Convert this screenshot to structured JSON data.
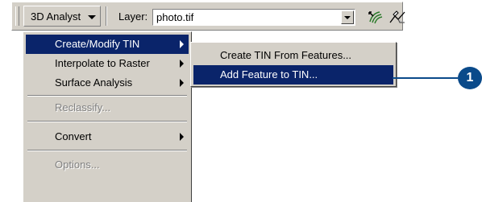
{
  "toolbar": {
    "analyst_button_label": "3D Analyst",
    "layer_label": "Layer:",
    "layer_value": "photo.tif",
    "tool_icons": [
      "contour-tool-icon",
      "interpolate-line-tool-icon"
    ]
  },
  "menu": {
    "items": [
      {
        "label": "Create/Modify TIN",
        "submenu": true,
        "highlighted": true,
        "disabled": false
      },
      {
        "label": "Interpolate to Raster",
        "submenu": true,
        "highlighted": false,
        "disabled": false
      },
      {
        "label": "Surface Analysis",
        "submenu": true,
        "highlighted": false,
        "disabled": false
      },
      {
        "label": "Reclassify...",
        "submenu": false,
        "highlighted": false,
        "disabled": true
      },
      {
        "label": "Convert",
        "submenu": true,
        "highlighted": false,
        "disabled": false
      },
      {
        "label": "Options...",
        "submenu": false,
        "highlighted": false,
        "disabled": true
      }
    ]
  },
  "submenu": {
    "items": [
      {
        "label": "Create TIN From Features...",
        "highlighted": false
      },
      {
        "label": "Add Feature to TIN...",
        "highlighted": true
      }
    ]
  },
  "callout": {
    "number": "1",
    "color": "#0a4a8a"
  },
  "colors": {
    "highlight": "#0a246a",
    "face": "#d4d0c8"
  }
}
